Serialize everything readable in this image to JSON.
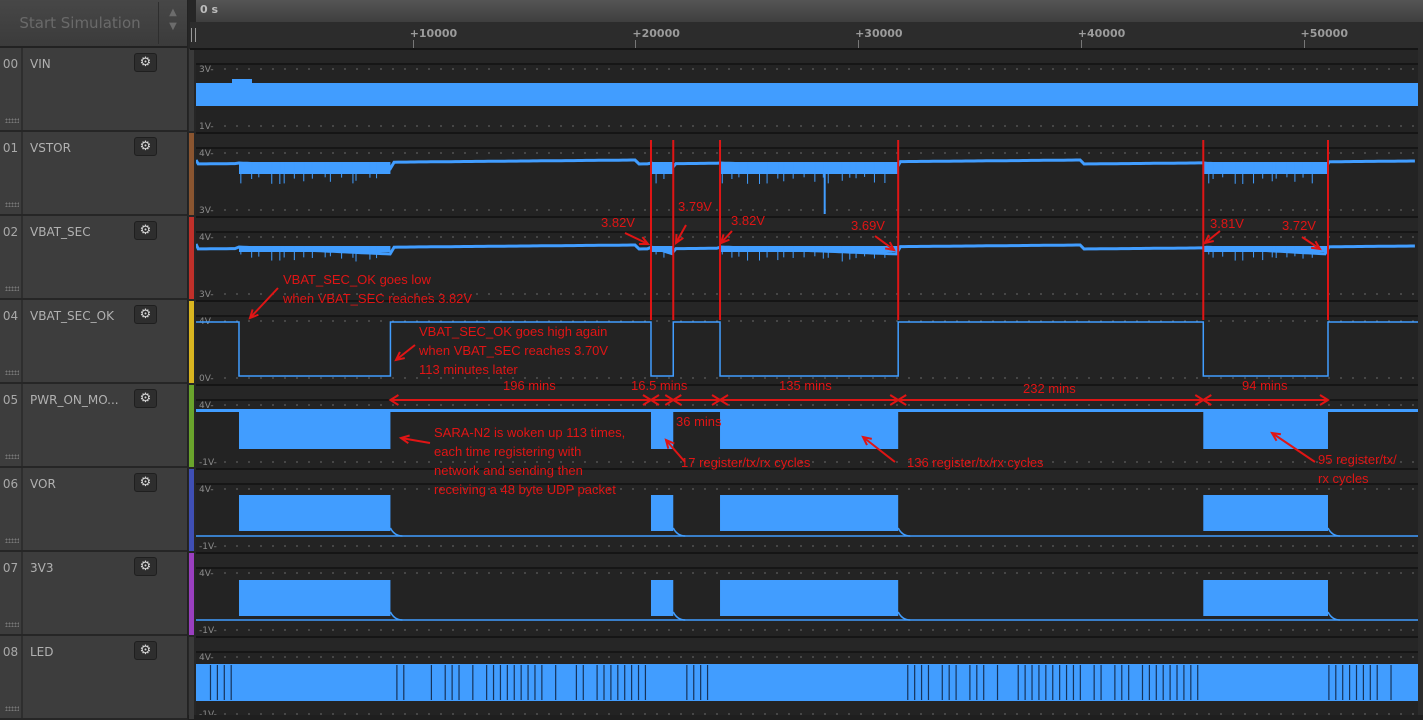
{
  "toolbar": {
    "start_simulation_label": "Start Simulation",
    "scroll_up_icon": "triangle-up",
    "scroll_down_icon": "triangle-down"
  },
  "timeline": {
    "current_time": "0 s",
    "ticks": [
      "+10000",
      "+20000",
      "+30000",
      "+40000",
      "+50000"
    ],
    "tick_values": [
      10000,
      20000,
      30000,
      40000,
      50000
    ],
    "range": [
      0,
      55000
    ]
  },
  "tracks": [
    {
      "index": "00",
      "name": "VIN",
      "color": "#3a3a3a",
      "ymax_label": "3V-",
      "ymin_label": "1V-"
    },
    {
      "index": "01",
      "name": "VSTOR",
      "color": "#8a5530",
      "ymax_label": "4V-",
      "ymin_label": "3V-"
    },
    {
      "index": "02",
      "name": "VBAT_SEC",
      "color": "#c0302a",
      "ymax_label": "4V-",
      "ymin_label": "3V-"
    },
    {
      "index": "04",
      "name": "VBAT_SEC_OK",
      "color": "#d9b520",
      "ymax_label": "4V-",
      "ymin_label": "0V-"
    },
    {
      "index": "05",
      "name": "PWR_ON_MO...",
      "color": "#6aa42c",
      "ymax_label": "4V-",
      "ymin_label": "-1V-"
    },
    {
      "index": "06",
      "name": "VOR",
      "color": "#3f4fb5",
      "ymax_label": "4V-",
      "ymin_label": "-1V-"
    },
    {
      "index": "07",
      "name": "3V3",
      "color": "#9a3fc0",
      "ymax_label": "4V-",
      "ymin_label": "-1V-"
    },
    {
      "index": "08",
      "name": "LED",
      "color": "#3a3a3a",
      "ymax_label": "4V-",
      "ymin_label": "-1V-"
    }
  ],
  "settings_icon": "gear-icon",
  "colors": {
    "trace": "#419dff",
    "annotation": "#e01515",
    "background": "#232323"
  },
  "events": {
    "low_periods": [
      [
        2200,
        9000
      ],
      [
        20700,
        21700
      ],
      [
        23800,
        31800
      ],
      [
        45500,
        51100
      ]
    ],
    "marker_times": [
      20700,
      21700,
      23800,
      31800,
      45500,
      51100
    ]
  },
  "annotations": {
    "voltage_labels": [
      "3.82V",
      "3.79V",
      "3.82V",
      "3.69V",
      "3.81V",
      "3.72V"
    ],
    "goes_low": [
      "VBAT_SEC_OK goes low",
      "when VBAT_SEC reaches 3.82V"
    ],
    "goes_high": [
      "VBAT_SEC_OK goes high again",
      "when VBAT_SEC reaches 3.70V",
      "113 minutes later"
    ],
    "durations": [
      "196 mins",
      "16.5 mins",
      "36 mins",
      "135 mins",
      "232 mins",
      "94 mins"
    ],
    "sara": [
      "SARA-N2 is woken up 113 times,",
      "each time registering with",
      "network and sending then",
      "receiving a 48 byte UDP packet"
    ],
    "cycles_17": "17 register/tx/rx cycles",
    "cycles_136": "136 register/tx/rx cycles",
    "cycles_95": [
      "95 register/tx/",
      "rx cycles"
    ]
  }
}
